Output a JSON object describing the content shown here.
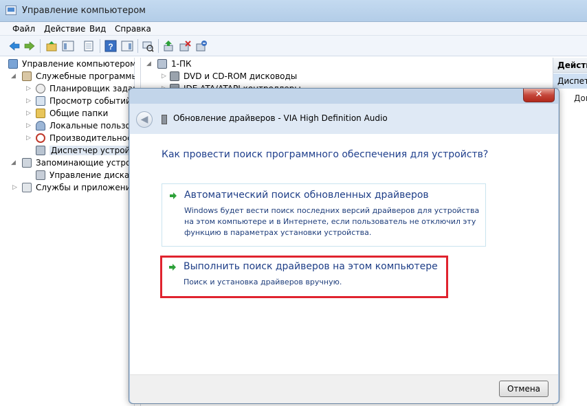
{
  "window": {
    "title": "Управление компьютером"
  },
  "menu": [
    "Файл",
    "Действие",
    "Вид",
    "Справка"
  ],
  "toolbar": {
    "icons": [
      "back-arrow-icon",
      "forward-arrow-icon",
      "up-folder-icon",
      "show-hide-tree-icon",
      "properties-icon",
      "help-icon",
      "show-hide-action-pane-icon",
      "scan-hardware-icon",
      "update-driver-icon",
      "disable-device-icon",
      "uninstall-device-icon"
    ]
  },
  "tree": {
    "items": [
      {
        "label": "Управление компьютером (л",
        "level": 0,
        "icon": "computer-management-icon"
      },
      {
        "label": "Служебные программы",
        "level": 1,
        "icon": "tools-icon",
        "expanded": true
      },
      {
        "label": "Планировщик заданий",
        "level": 2,
        "icon": "clock-icon"
      },
      {
        "label": "Просмотр событий",
        "level": 2,
        "icon": "event-viewer-icon"
      },
      {
        "label": "Общие папки",
        "level": 2,
        "icon": "shared-folder-icon"
      },
      {
        "label": "Локальные пользова",
        "level": 2,
        "icon": "users-icon"
      },
      {
        "label": "Производительность",
        "level": 2,
        "icon": "performance-icon"
      },
      {
        "label": "Диспетчер устройств",
        "level": 2,
        "icon": "device-manager-icon",
        "selected": true
      },
      {
        "label": "Запоминающие устрой",
        "level": 1,
        "icon": "storage-icon",
        "expanded": true
      },
      {
        "label": "Управление дисками",
        "level": 2,
        "icon": "disk-management-icon"
      },
      {
        "label": "Службы и приложения",
        "level": 1,
        "icon": "services-icon"
      }
    ]
  },
  "devices": {
    "root": "1-ПК",
    "items": [
      "DVD и CD-ROM дисководы",
      "IDE ATA/ATAPI контроллеры"
    ]
  },
  "actions": {
    "header": "Действия",
    "selected": "Диспетчер устройств",
    "item": "Дополнительные действия"
  },
  "dialog": {
    "title": "Обновление драйверов - VIA High Definition Audio",
    "close_label": "✕",
    "back_label": "◀",
    "question": "Как провести поиск программного обеспечения для устройств?",
    "option_auto": {
      "title": "Автоматический поиск обновленных драйверов",
      "description": "Windows будет вести поиск последних версий драйверов для устройства на этом компьютере и в Интернете, если пользователь не отключил эту функцию в параметрах установки устройства."
    },
    "option_manual": {
      "title": "Выполнить поиск драйверов на этом компьютере",
      "description": "Поиск и установка драйверов вручную."
    },
    "cancel_label": "Отмена"
  },
  "colors": {
    "link_blue": "#1e3e87",
    "highlight_red": "#e0232e",
    "arrow_green": "#2ea13a"
  }
}
